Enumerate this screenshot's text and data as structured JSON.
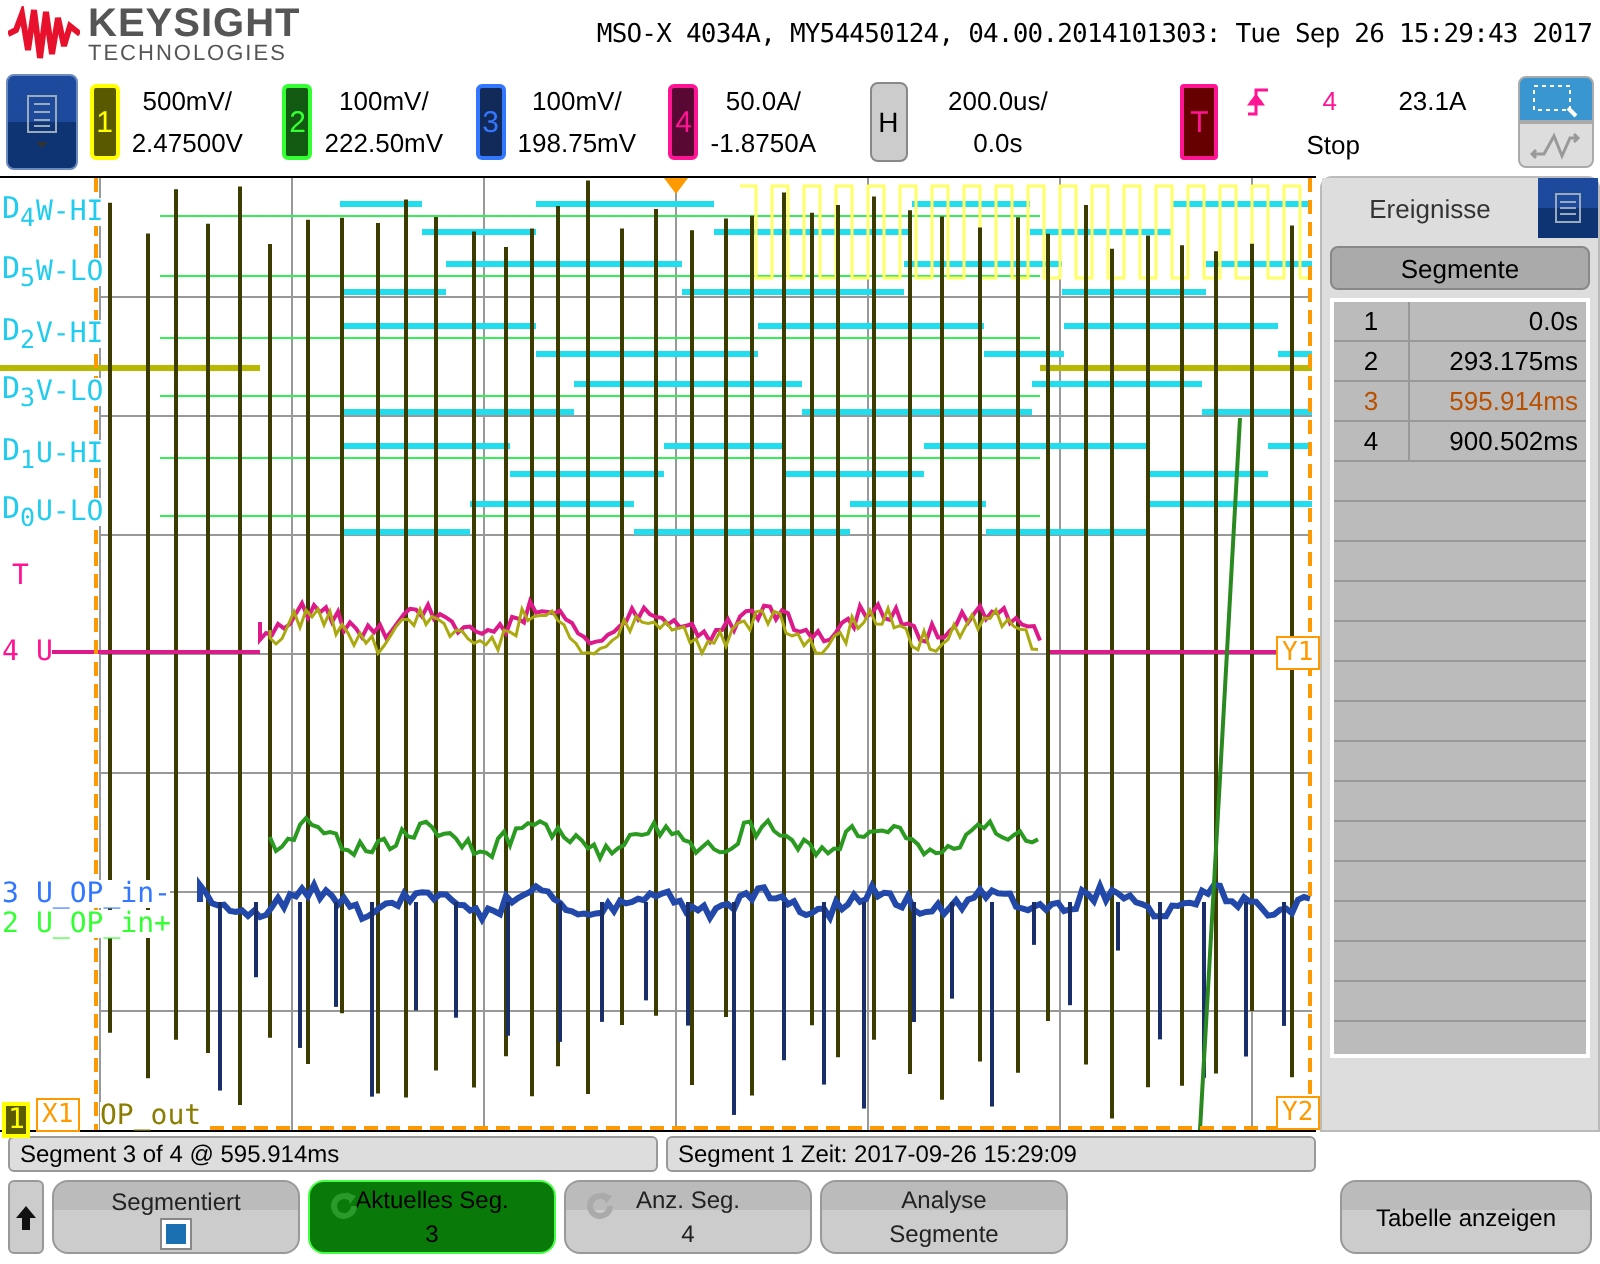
{
  "header": {
    "brand": "KEYSIGHT",
    "tagline": "TECHNOLOGIES",
    "title": "MSO-X 4034A, MY54450124, 04.00.2014101303: Tue Sep 26 15:29:43 2017"
  },
  "channels": [
    {
      "number": "1",
      "scale": "500mV/",
      "offset": "2.47500V",
      "color": "#ffff00"
    },
    {
      "number": "2",
      "scale": "100mV/",
      "offset": "222.50mV",
      "color": "#33ff33"
    },
    {
      "number": "3",
      "scale": "100mV/",
      "offset": "198.75mV",
      "color": "#3377ff"
    },
    {
      "number": "4",
      "scale": "50.0A/",
      "offset": "-1.8750A",
      "color": "#ff1493"
    }
  ],
  "horizontal": {
    "label": "H",
    "scale": "200.0us/",
    "delay": "0.0s"
  },
  "trigger": {
    "label": "T",
    "source": "4",
    "level": "23.1A",
    "status": "Stop"
  },
  "display": {
    "digital_labels": [
      {
        "channel": "D$_{4}$",
        "name": "W-HI"
      },
      {
        "channel": "D$_{5}$",
        "name": "W-LO"
      },
      {
        "channel": "D$_{2}$",
        "name": "V-HI"
      },
      {
        "channel": "D$_{3}$",
        "name": "V-LO"
      },
      {
        "channel": "D$_{1}$",
        "name": "U-HI"
      },
      {
        "channel": "D$_{0}$",
        "name": "U-LO"
      }
    ],
    "trigger_marker": "T",
    "analog_labels": [
      {
        "channel": "4",
        "name": "U",
        "color": "#ff1493"
      },
      {
        "channel": "3",
        "name": "U_OP_in-",
        "color": "#3377ff"
      },
      {
        "channel": "2",
        "name": "U_OP_in+",
        "color": "#33ff33"
      },
      {
        "channel": "1",
        "name": "OP_out",
        "color": "#ffff00"
      }
    ],
    "cursors": [
      "X1",
      "Y1",
      "Y2"
    ]
  },
  "side_panel": {
    "tab": "Ereignisse",
    "header": "Segmente",
    "rows": [
      {
        "index": "1",
        "time": "0.0s",
        "selected": false
      },
      {
        "index": "2",
        "time": "293.175ms",
        "selected": false
      },
      {
        "index": "3",
        "time": "595.914ms",
        "selected": true
      },
      {
        "index": "4",
        "time": "900.502ms",
        "selected": false
      }
    ]
  },
  "status_bar": [
    "Segment 3 of 4 @ 595.914ms",
    "Segment 1 Zeit: 2017-09-26 15:29:09"
  ],
  "softkeys": [
    {
      "kind": "toggle",
      "label": "Segmentiert",
      "checked": true
    },
    {
      "kind": "knob",
      "label": "Aktuelles Seg.",
      "value": "3",
      "selected": true
    },
    {
      "kind": "knob",
      "label": "Anz. Seg.",
      "value": "4",
      "selected": false
    },
    {
      "kind": "action",
      "label": "Analyse",
      "value": "Segmente"
    }
  ],
  "table_button": "Tabelle anzeigen"
}
